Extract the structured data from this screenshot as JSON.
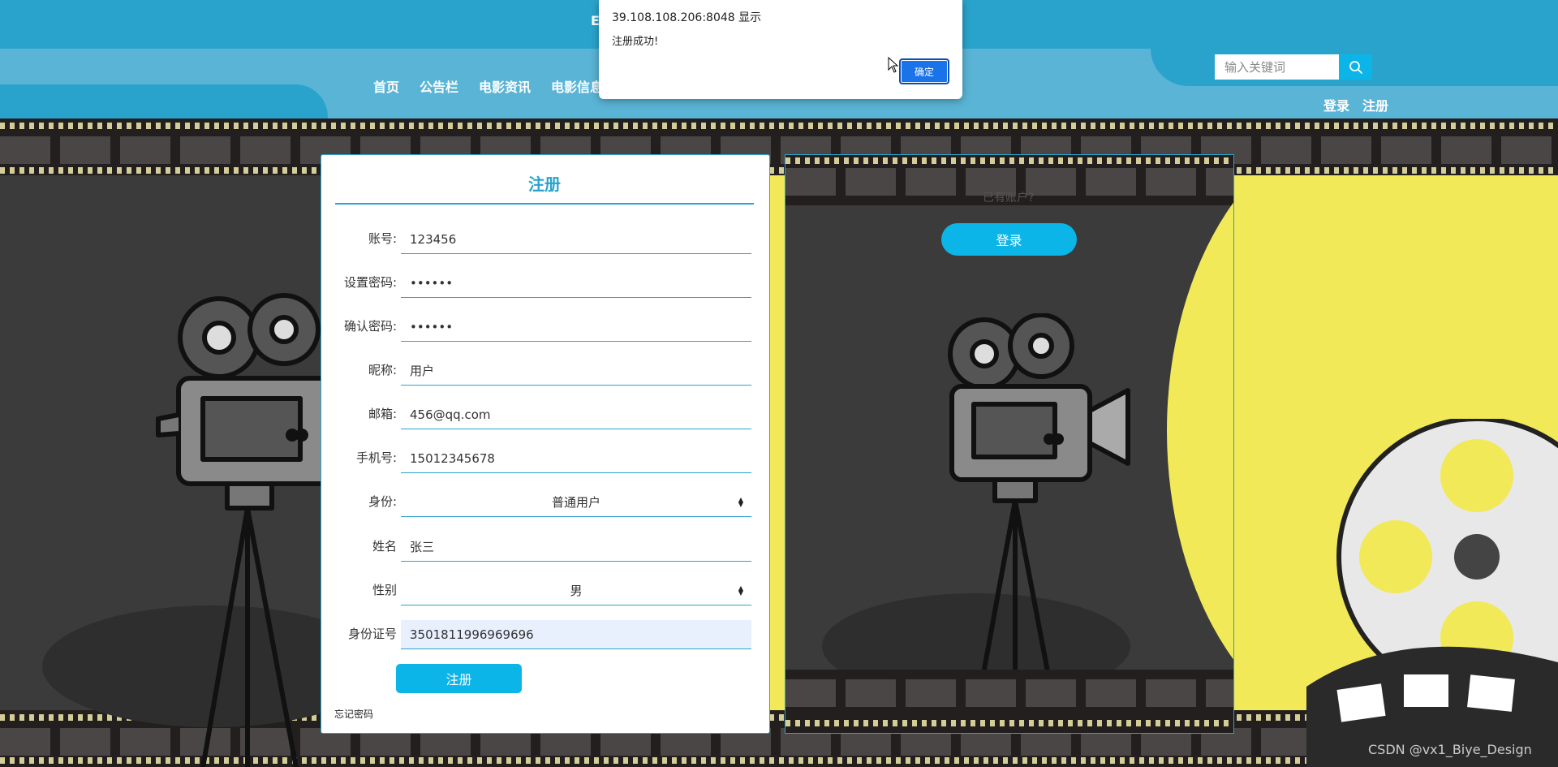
{
  "header": {
    "title": "E",
    "nav": [
      "首页",
      "公告栏",
      "电影资讯",
      "电影信息"
    ],
    "search_placeholder": "输入关键词",
    "auth": [
      "登录",
      "注册"
    ]
  },
  "register": {
    "title": "注册",
    "fields": [
      {
        "label": "账号:",
        "value": "123456"
      },
      {
        "label": "设置密码:",
        "value": "••••••"
      },
      {
        "label": "确认密码:",
        "value": "••••••"
      },
      {
        "label": "昵称:",
        "value": "用户"
      },
      {
        "label": "邮箱:",
        "value": "456@qq.com"
      },
      {
        "label": "手机号:",
        "value": "15012345678"
      },
      {
        "label": "身份:",
        "value": "普通用户"
      },
      {
        "label": "姓名",
        "value": "张三"
      },
      {
        "label": "性别",
        "value": "男"
      },
      {
        "label": "身份证号",
        "value": "3501811996969696"
      }
    ],
    "submit_label": "注册",
    "forgot_label": "忘记密码"
  },
  "panel": {
    "hint": "已有账户?",
    "login_label": "登录"
  },
  "dialog": {
    "origin": "39.108.108.206:8048 显示",
    "message": "注册成功!",
    "ok_label": "确定"
  },
  "watermark": "CSDN @vx1_Biye_Design",
  "colors": {
    "header_blue": "#2aa3cc",
    "nav_band": "#5ab4d6",
    "accent": "#0bb5e8",
    "scene_yellow": "#f1e957",
    "scene_dark": "#3b3b3b"
  }
}
